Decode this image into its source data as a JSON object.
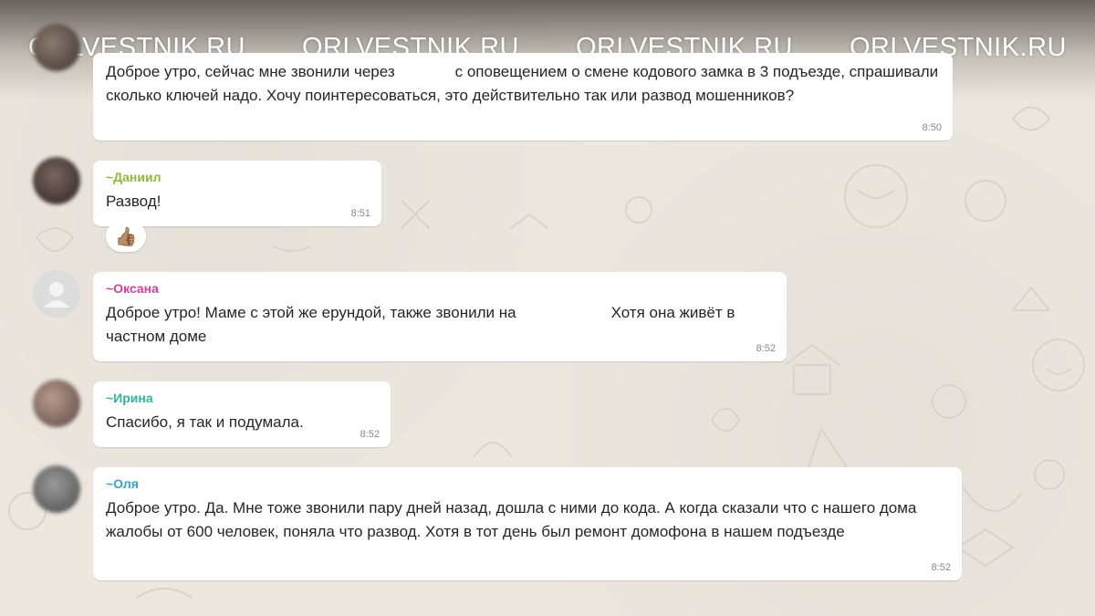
{
  "watermarks": [
    "ORLVESTNIK.RU",
    "ORLVESTNIK.RU",
    "ORLVESTNIK.RU",
    "ORLVESTNIK.RU"
  ],
  "messages": [
    {
      "sender": "",
      "text_a": "Доброе утро, сейчас мне звонили через",
      "text_b": "с оповещением о смене кодового замка в 3 подъезде, спрашивали сколько ключей надо. Хочу поинтересоваться,  это действительно так или развод мошенников?",
      "time": "8:50"
    },
    {
      "sender": "~Даниил",
      "sender_color": "#8fb93a",
      "text": "Развод!",
      "time": "8:51",
      "reaction": "👍🏽"
    },
    {
      "sender": "~Оксана",
      "sender_color": "#d1409b",
      "text_a": "Доброе утро! Маме с этой же ерундой, также звонили на",
      "text_b": "Хотя она живёт в частном доме",
      "time": "8:52"
    },
    {
      "sender": "~Ирина",
      "sender_color": "#2fb59a",
      "text": "Спасибо, я так и подумала.",
      "time": "8:52"
    },
    {
      "sender": "~Оля",
      "sender_color": "#3aa3c9",
      "text": "Доброе утро. Да. Мне тоже звонили пару дней назад, дошла с ними до кода. А когда сказали что с нашего дома жалобы от 600 человек, поняла что развод. Хотя в тот день был ремонт домофона в нашем подъезде",
      "time": "8:52"
    }
  ],
  "colors": {
    "background": "#ece7df",
    "bubble": "#ffffff",
    "timestamp": "#8a8a8a"
  }
}
